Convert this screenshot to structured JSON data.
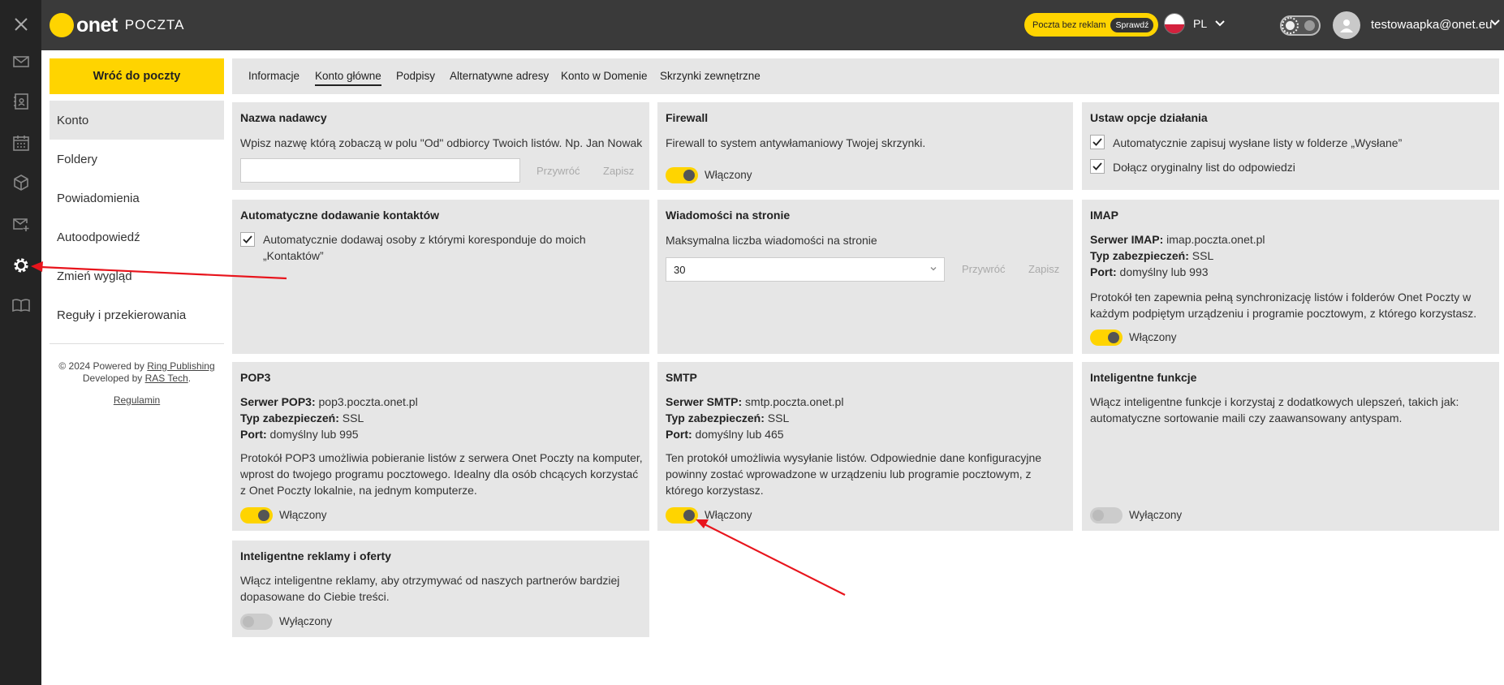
{
  "app": {
    "logo_brand": "onet",
    "logo_product": "POCZTA",
    "promo_text": "Poczta bez reklam",
    "promo_button": "Sprawdź",
    "language": "PL",
    "user_email": "testowaapka@onet.eu"
  },
  "sidebar": {
    "back_button": "Wróć do poczty",
    "items": [
      {
        "label": "Konto",
        "active": true
      },
      {
        "label": "Foldery"
      },
      {
        "label": "Powiadomienia"
      },
      {
        "label": "Autoodpowiedź"
      },
      {
        "label": "Zmień wygląd"
      },
      {
        "label": "Reguły i przekierowania"
      }
    ],
    "footer": {
      "line1_prefix": "© 2024 Powered by ",
      "line1_link": "Ring Publishing",
      "line2_prefix": "Developed by ",
      "line2_link": "RAS Tech",
      "line2_suffix": ".",
      "regulamin": "Regulamin"
    }
  },
  "tabs": [
    {
      "label": "Informacje"
    },
    {
      "label": "Konto główne",
      "active": true
    },
    {
      "label": "Podpisy"
    },
    {
      "label": "Alternatywne adresy"
    },
    {
      "label": "Konto w Domenie"
    },
    {
      "label": "Skrzynki zewnętrzne"
    }
  ],
  "cards": {
    "sender": {
      "title": "Nazwa nadawcy",
      "description": "Wpisz nazwę którą zobaczą w polu \"Od\" odbiorcy Twoich listów. Np. Jan Nowak",
      "input_value": "",
      "restore": "Przywróć",
      "save": "Zapisz"
    },
    "firewall": {
      "title": "Firewall",
      "description": "Firewall to system antywłamaniowy Twojej skrzynki.",
      "toggle_label": "Włączony"
    },
    "options": {
      "title": "Ustaw opcje działania",
      "check1": "Automatycznie zapisuj wysłane listy w folderze „Wysłane”",
      "check2": "Dołącz oryginalny list do odpowiedzi"
    },
    "contacts": {
      "title": "Automatyczne dodawanie kontaktów",
      "check1_line1": "Automatycznie dodawaj osoby z którymi koresponduje do moich",
      "check1_line2": "„Kontaktów”"
    },
    "messages": {
      "title": "Wiadomości na stronie",
      "description": "Maksymalna liczba wiadomości na stronie",
      "select_value": "30",
      "restore": "Przywróć",
      "save": "Zapisz"
    },
    "imap": {
      "title": "IMAP",
      "server_label": "Serwer IMAP:",
      "server_value": " imap.poczta.onet.pl",
      "security_label": "Typ zabezpieczeń:",
      "security_value": " SSL",
      "port_label": "Port:",
      "port_value": " domyślny lub 993",
      "desc_line1": "Protokół ten zapewnia pełną synchronizację listów i folderów Onet Poczty w",
      "desc_line2": "każdym podpiętym urządzeniu i programie pocztowym, z którego korzystasz.",
      "toggle_label": "Włączony"
    },
    "pop3": {
      "title": "POP3",
      "server_label": "Serwer POP3:",
      "server_value": " pop3.poczta.onet.pl",
      "security_label": "Typ zabezpieczeń:",
      "security_value": " SSL",
      "port_label": "Port:",
      "port_value": " domyślny lub 995",
      "desc_line1": "Protokół POP3 umożliwia pobieranie listów z serwera Onet Poczty na komputer,",
      "desc_line2": "wprost do twojego programu pocztowego. Idealny dla osób chcących korzystać",
      "desc_line3": "z Onet Poczty lokalnie, na jednym komputerze.",
      "toggle_label": "Włączony"
    },
    "smtp": {
      "title": "SMTP",
      "server_label": "Serwer SMTP:",
      "server_value": " smtp.poczta.onet.pl",
      "security_label": "Typ zabezpieczeń:",
      "security_value": " SSL",
      "port_label": "Port:",
      "port_value": " domyślny lub 465",
      "desc_line1": "Ten protokół umożliwia wysyłanie listów. Odpowiednie dane konfiguracyjne",
      "desc_line2": "powinny zostać wprowadzone w urządzeniu lub programie pocztowym, z",
      "desc_line3": "którego korzystasz.",
      "toggle_label": "Włączony"
    },
    "smart": {
      "title": "Inteligentne funkcje",
      "desc_line1": "Włącz inteligentne funkcje i korzystaj z dodatkowych ulepszeń, takich jak:",
      "desc_line2": "automatyczne sortowanie maili czy zaawansowany antyspam.",
      "toggle_label": "Wyłączony"
    },
    "ads": {
      "title": "Inteligentne reklamy i oferty",
      "desc_line1": "Włącz inteligentne reklamy, aby otrzymywać od naszych partnerów bardziej",
      "desc_line2": "dopasowane do Ciebie treści.",
      "toggle_label": "Wyłączony"
    }
  },
  "colors": {
    "accent": "#ffd400",
    "topbar": "#3a3a3a",
    "rail": "#242424",
    "card": "#e6e6e6",
    "annotation_arrow": "#e8141c"
  }
}
